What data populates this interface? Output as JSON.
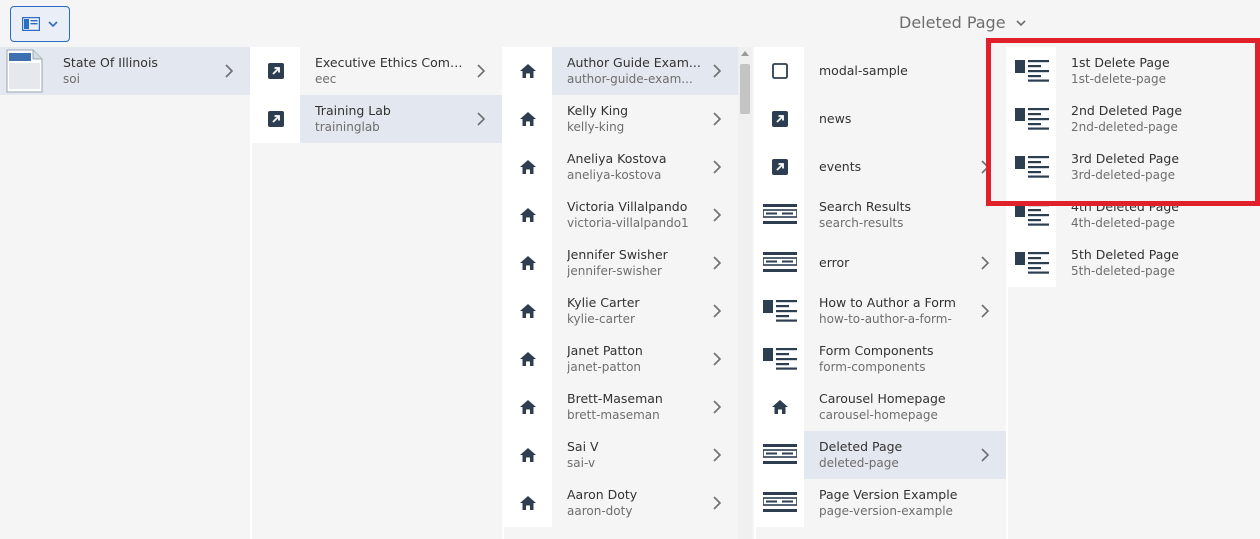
{
  "toolbar": {
    "view_toggle_label": "view-toggle"
  },
  "header": {
    "title": "Deleted Page"
  },
  "columns": {
    "c1": [
      {
        "title": "State Of Illinois",
        "sub": "soi",
        "icon": "page-thumbnail-icon"
      }
    ],
    "c2": [
      {
        "title": "Executive Ethics Comm...",
        "sub": "eec",
        "icon": "link-icon"
      },
      {
        "title": "Training Lab",
        "sub": "traininglab",
        "icon": "link-icon"
      }
    ],
    "c3": [
      {
        "title": "Author Guide Exam...",
        "sub": "author-guide-exam...",
        "icon": "home-icon"
      },
      {
        "title": "Kelly King",
        "sub": "kelly-king",
        "icon": "home-icon"
      },
      {
        "title": "Aneliya Kostova",
        "sub": "aneliya-kostova",
        "icon": "home-icon"
      },
      {
        "title": "Victoria Villalpando",
        "sub": "victoria-villalpando1",
        "icon": "home-icon"
      },
      {
        "title": "Jennifer Swisher",
        "sub": "jennifer-swisher",
        "icon": "home-icon"
      },
      {
        "title": "Kylie Carter",
        "sub": "kylie-carter",
        "icon": "home-icon"
      },
      {
        "title": "Janet Patton",
        "sub": "janet-patton",
        "icon": "home-icon"
      },
      {
        "title": "Brett-Maseman",
        "sub": "brett-maseman",
        "icon": "home-icon"
      },
      {
        "title": "Sai V",
        "sub": "sai-v",
        "icon": "home-icon"
      },
      {
        "title": "Aaron Doty",
        "sub": "aaron-doty",
        "icon": "home-icon"
      }
    ],
    "c4": [
      {
        "title": "modal-sample",
        "sub": "",
        "icon": "square-icon"
      },
      {
        "title": "news",
        "sub": "",
        "icon": "link-icon"
      },
      {
        "title": "events",
        "sub": "",
        "icon": "link-icon"
      },
      {
        "title": "Search Results",
        "sub": "search-results",
        "icon": "search-template-icon"
      },
      {
        "title": "error",
        "sub": "",
        "icon": "search-template-icon"
      },
      {
        "title": "How to Author a Form",
        "sub": "how-to-author-a-form-",
        "icon": "content-template-icon"
      },
      {
        "title": "Form Components",
        "sub": "form-components",
        "icon": "content-template-icon"
      },
      {
        "title": "Carousel Homepage",
        "sub": "carousel-homepage",
        "icon": "home-icon"
      },
      {
        "title": "Deleted Page",
        "sub": "deleted-page",
        "icon": "search-template-icon"
      },
      {
        "title": "Page Version Example",
        "sub": "page-version-example",
        "icon": "search-template-icon"
      }
    ],
    "c5": [
      {
        "title": "1st Delete Page",
        "sub": "1st-delete-page",
        "icon": "content-template-icon"
      },
      {
        "title": "2nd Deleted Page",
        "sub": "2nd-deleted-page",
        "icon": "content-template-icon"
      },
      {
        "title": "3rd Deleted Page",
        "sub": "3rd-deleted-page",
        "icon": "content-template-icon"
      },
      {
        "title": "4th Deleted Page",
        "sub": "4th-deleted-page",
        "icon": "content-template-icon"
      },
      {
        "title": "5th Deleted Page",
        "sub": "5th-deleted-page",
        "icon": "content-template-icon"
      }
    ]
  },
  "colors": {
    "accent": "#2b6cc4",
    "selected_bg": "#e3e7ef",
    "highlight": "#e0202a",
    "icon": "#2c3e50"
  }
}
